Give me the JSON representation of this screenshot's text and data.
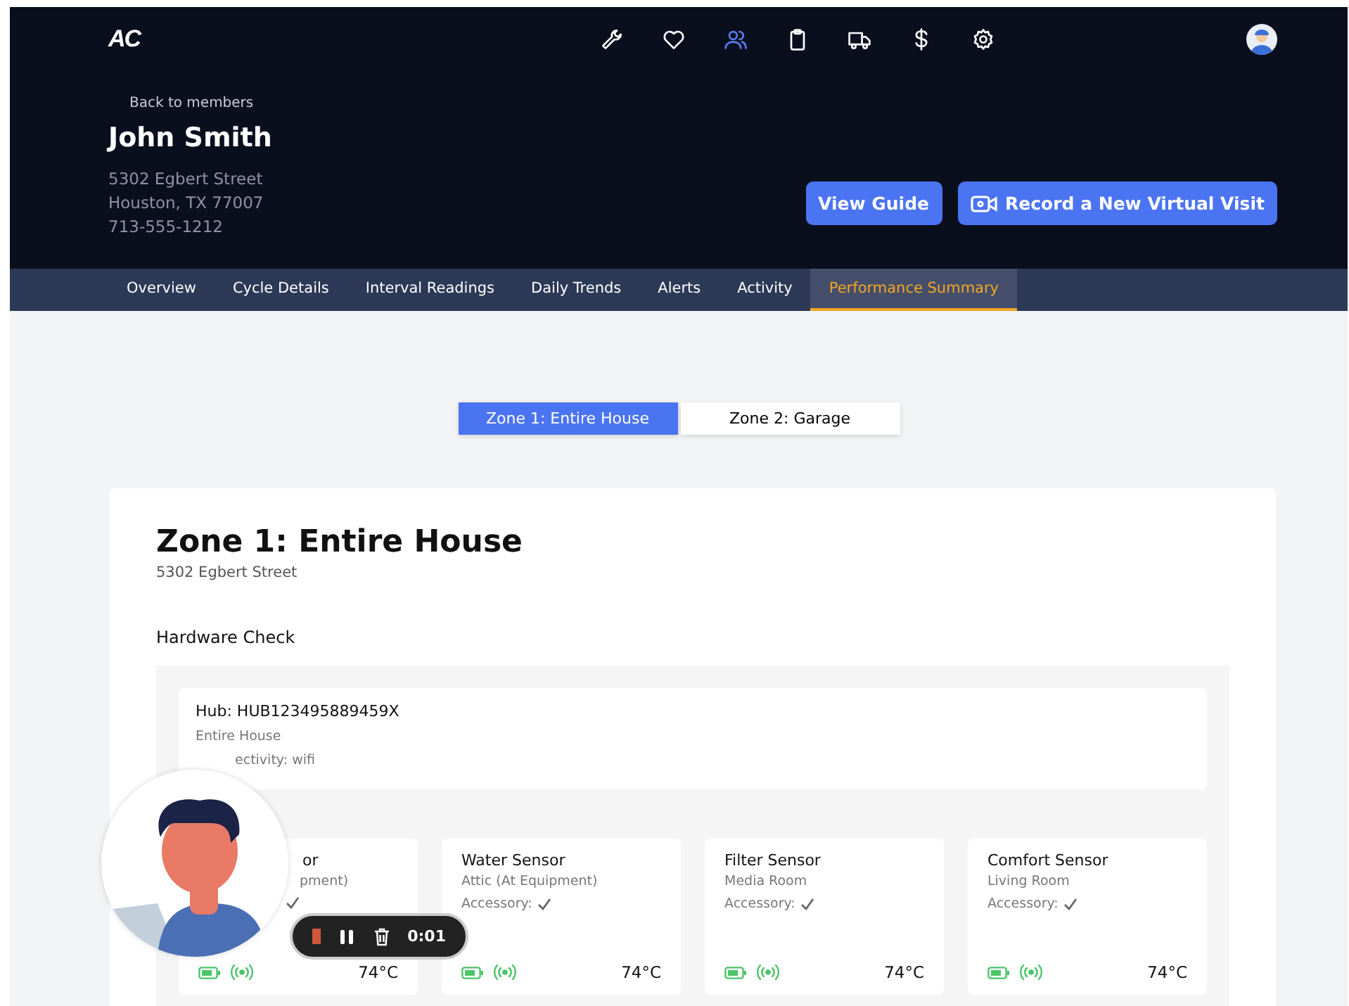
{
  "header": {
    "logo": "AC",
    "nav": [
      {
        "selected": false
      },
      {
        "selected": false
      },
      {
        "selected": true
      },
      {
        "selected": false
      },
      {
        "selected": false
      },
      {
        "selected": false
      },
      {
        "selected": false
      }
    ],
    "back_link": "Back to members",
    "name": "John Smith",
    "address_lines": [
      "5302 Egbert Street",
      "Houston, TX 77007",
      "713-555-1212"
    ],
    "buttons": [
      {
        "label": "View Guide",
        "kind": "plain"
      },
      {
        "label": "Record a New Virtual Visit",
        "kind": "video"
      }
    ]
  },
  "tabs": [
    {
      "label": "Overview",
      "selected": false
    },
    {
      "label": "Cycle Details",
      "selected": false
    },
    {
      "label": "Interval Readings",
      "selected": false
    },
    {
      "label": "Daily Trends",
      "selected": false
    },
    {
      "label": "Alerts",
      "selected": false
    },
    {
      "label": "Activity",
      "selected": false
    },
    {
      "label": "Performance Summary",
      "selected": true
    }
  ],
  "zones": [
    {
      "label": "Zone 1: Entire House",
      "selected": true
    },
    {
      "label": "Zone 2: Garage",
      "selected": false
    }
  ],
  "zone_card": {
    "title": "Zone 1: Entire House",
    "subtitle": "5302 Egbert Street",
    "section": "Hardware Check",
    "hub": {
      "id": "Hub: HUB123495889459X",
      "location": "Entire House",
      "connectivity": "ectivity: wifi"
    },
    "sensors": [
      {
        "name": "or",
        "location": "pment)",
        "accessory_ok": true,
        "temperature": "74°C",
        "covered": true
      },
      {
        "name": "Water Sensor",
        "location": "Attic (At Equipment)",
        "accessory": "Accessory:",
        "accessory_ok": true,
        "temperature": "74°C",
        "covered": false
      },
      {
        "name": "Filter Sensor",
        "location": "Media Room",
        "accessory": "Accessory:",
        "accessory_ok": true,
        "temperature": "74°C",
        "covered": false
      },
      {
        "name": "Comfort Sensor",
        "location": "Living Room",
        "accessory": "Accessory:",
        "accessory_ok": true,
        "temperature": "74°C",
        "covered": false
      }
    ]
  },
  "recorder": {
    "time": "0:01"
  }
}
